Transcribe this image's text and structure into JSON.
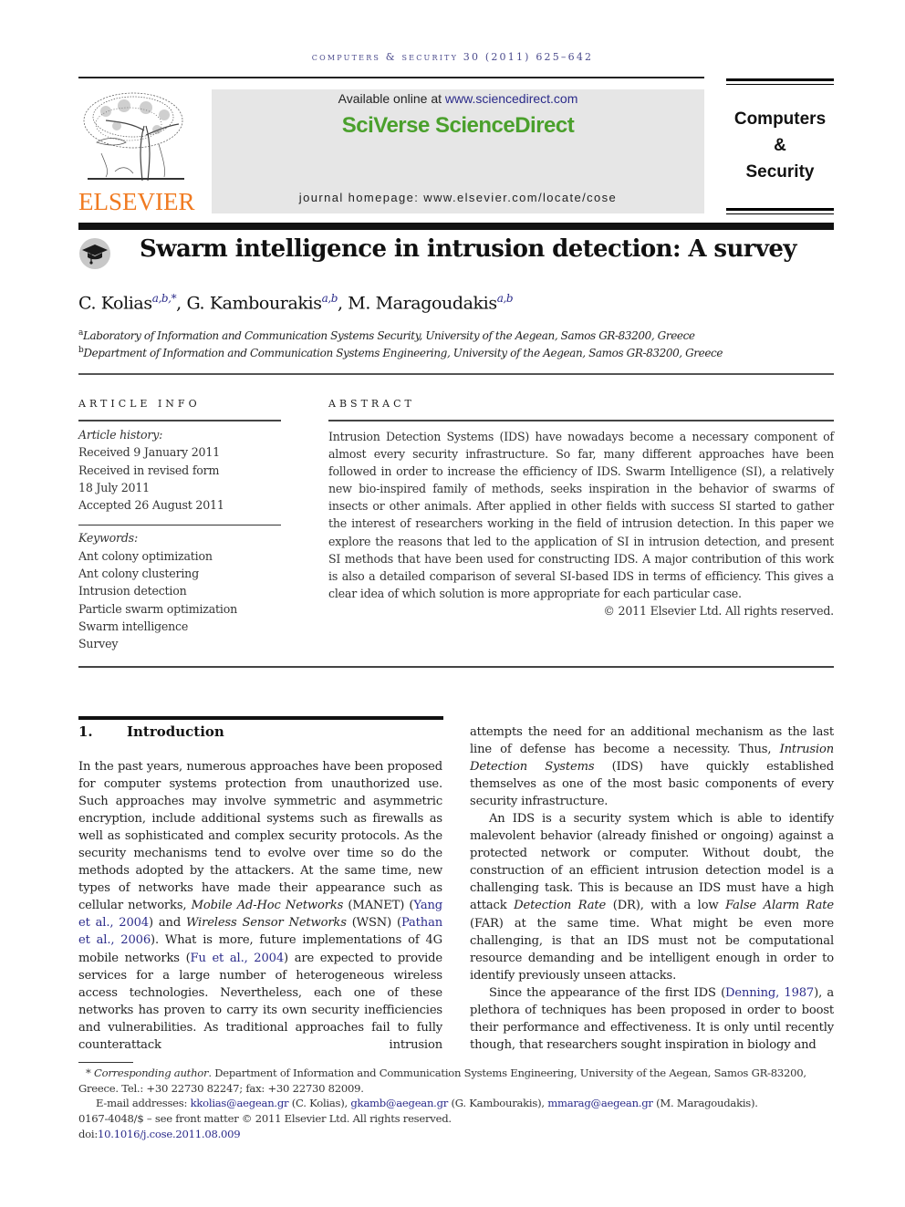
{
  "running_header": "computers & security 30 (2011) 625–642",
  "publisher": {
    "logo_word": "ELSEVIER",
    "available_online_prefix": "Available online at ",
    "available_online_link": "www.sciencedirect.com",
    "platform": "SciVerse ScienceDirect",
    "homepage": "journal homepage: www.elsevier.com/locate/cose"
  },
  "journal_brand": {
    "line1": "Computers",
    "line2": "&",
    "line3": "Security"
  },
  "colors": {
    "elsevier_orange": "#f07a20",
    "sciverse_green": "#4aa02c",
    "link_blue": "#2b2b8a",
    "banner_gray": "#e6e6e6"
  },
  "article": {
    "open_access_icon": "mortarboard-icon",
    "title": "Swarm intelligence in intrusion detection: A survey",
    "authors": [
      {
        "name": "C. Kolias",
        "sup": "a,b,*",
        "sep": ", "
      },
      {
        "name": "G. Kambourakis",
        "sup": "a,b",
        "sep": ", "
      },
      {
        "name": "M. Maragoudakis",
        "sup": "a,b",
        "sep": ""
      }
    ],
    "affiliations": [
      {
        "mark": "a",
        "text": "Laboratory of Information and Communication Systems Security, University of the Aegean, Samos GR-83200, Greece"
      },
      {
        "mark": "b",
        "text": "Department of Information and Communication Systems Engineering, University of the Aegean, Samos GR-83200, Greece"
      }
    ]
  },
  "article_info": {
    "heading": "ARTICLE INFO",
    "history_label": "Article history:",
    "history": [
      "Received 9 January 2011",
      "Received in revised form",
      "18 July 2011",
      "Accepted 26 August 2011"
    ],
    "keywords_label": "Keywords:",
    "keywords": [
      "Ant colony optimization",
      "Ant colony clustering",
      "Intrusion detection",
      "Particle swarm optimization",
      "Swarm intelligence",
      "Survey"
    ]
  },
  "abstract": {
    "heading": "ABSTRACT",
    "text": "Intrusion Detection Systems (IDS) have nowadays become a necessary component of almost every security infrastructure. So far, many different approaches have been followed in order to increase the efficiency of IDS. Swarm Intelligence (SI), a relatively new bio-inspired family of methods, seeks inspiration in the behavior of swarms of insects or other animals. After applied in other fields with success SI started to gather the interest of researchers working in the field of intrusion detection. In this paper we explore the reasons that led to the application of SI in intrusion detection, and present SI methods that have been used for constructing IDS. A major contribution of this work is also a detailed comparison of several SI-based IDS in terms of efficiency. This gives a clear idea of which solution is more appropriate for each particular case.",
    "copyright": "© 2011 Elsevier Ltd. All rights reserved."
  },
  "introduction": {
    "number": "1.",
    "title": "Introduction",
    "p1": {
      "a": "In the past years, numerous approaches have been proposed for computer systems protection from unauthorized use. Such approaches may involve symmetric and asymmetric encryp­tion, include additional systems such as firewalls as well as sophisticated and complex security protocols. As the security mechanisms tend to evolve over time so do the methods adopted by the attackers. At the same time, new types of networks have made their appearance such as cellular networks, ",
      "it1": "Mobile Ad-Hoc Networks",
      "b": " (MANET) (",
      "ref1": "Yang et al., 2004",
      "c": ") and ",
      "it2": "Wireless Sensor Networks",
      "d": " (WSN) (",
      "ref2": "Pathan et al., 2006",
      "e": "). What is more, future implementations of 4G mobile networks (",
      "ref3": "Fu et al., 2004",
      "f": ") are expected to provide services for a large number of heterogeneous wireless access technologies. Nevertheless, each one of these networks has proven to carry its own security inefficiencies and vulnerabilities. As tradi­tional approaches fail to fully counterattack intrusion attempts the need for an additional mechanism as the last line of defense has become a necessity. Thus, ",
      "it3": "Intrusion Detec­tion Systems",
      "g": " (IDS) have quickly established themselves as one of the most basic components of every security infrastructure."
    },
    "p2": {
      "a": "An IDS is a security system which is able to identify malevolent behavior (already finished or ongoing) against a protected network or computer. Without doubt, the construction of an efficient intrusion detection model is a challenging task. This is because an IDS must have a high attack ",
      "it1": "Detection Rate",
      "b": " (DR), with a low ",
      "it2": "False Alarm Rate",
      "c": " (FAR) at the same time. What might be even more challenging, is that an IDS must not be computational resource demanding and be intelligent enough in order to identify previously unseen attacks."
    },
    "p3": {
      "a": "Since the appearance of the first IDS (",
      "ref1": "Denning, 1987",
      "b": "), a plethora of techniques has been proposed in order to boost their performance and effectiveness. It is only until recently though, that researchers sought inspiration in biology and"
    }
  },
  "footnotes": {
    "corr_mark": "*",
    "corr_label": "Corresponding author",
    "corr_text": ". Department of Information and Communication Systems Engineering, University of the Aegean, Samos GR-83200, Greece. Tel.: +30 22730 82247; fax: +30 22730 82009.",
    "email_label": "E-mail addresses: ",
    "emails": [
      {
        "addr": "kkolias@aegean.gr",
        "who": " (C. Kolias), "
      },
      {
        "addr": "gkamb@aegean.gr",
        "who": " (G. Kambourakis), "
      },
      {
        "addr": "mmarag@aegean.gr",
        "who": " (M. Maragoudakis)."
      }
    ],
    "front_matter": "0167-4048/$ – see front matter © 2011 Elsevier Ltd. All rights reserved.",
    "doi_prefix": "doi:",
    "doi": "10.1016/j.cose.2011.08.009"
  }
}
